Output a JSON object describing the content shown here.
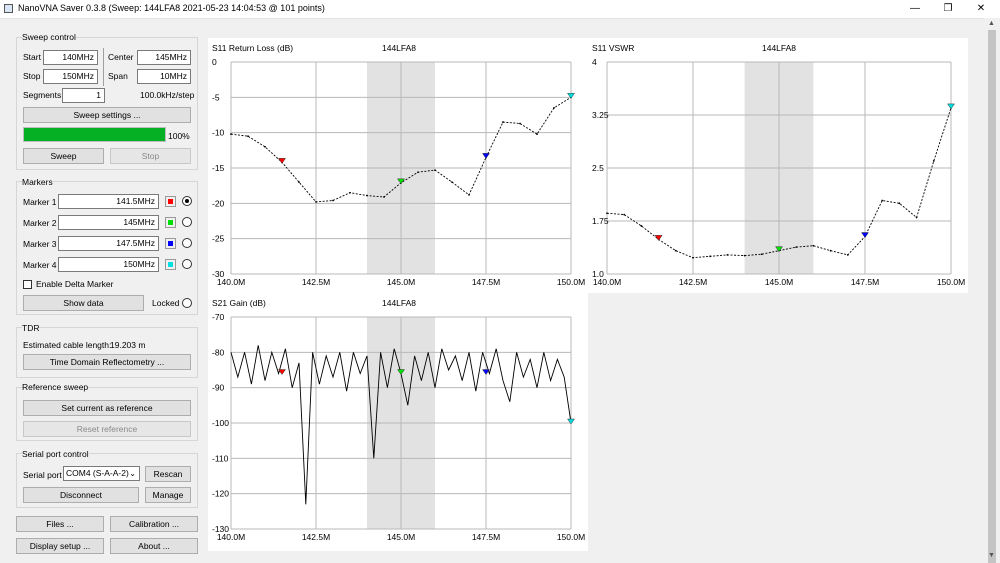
{
  "window": {
    "title": "NanoVNA Saver 0.3.8 (Sweep: 144LFA8 2021-05-23 14:04:53 @ 101 points)",
    "minimize": "—",
    "restore": "❐",
    "close": "✕"
  },
  "sweep_control": {
    "title": "Sweep control",
    "start_label": "Start",
    "start_value": "140MHz",
    "center_label": "Center",
    "center_value": "145MHz",
    "stop_label": "Stop",
    "stop_value": "150MHz",
    "span_label": "Span",
    "span_value": "10MHz",
    "segments_label": "Segments",
    "segments_value": "1",
    "step": "100.0kHz/step",
    "settings_button": "Sweep settings ...",
    "progress": 100,
    "progress_label": "100%",
    "sweep_button": "Sweep",
    "stop_button": "Stop"
  },
  "markers": {
    "title": "Markers",
    "items": [
      {
        "label": "Marker 1",
        "value": "141.5MHz",
        "color": "#ff0000",
        "selected": true
      },
      {
        "label": "Marker 2",
        "value": "145MHz",
        "color": "#00e000",
        "selected": false
      },
      {
        "label": "Marker 3",
        "value": "147.5MHz",
        "color": "#0000ff",
        "selected": false
      },
      {
        "label": "Marker 4",
        "value": "150MHz",
        "color": "#00e0e0",
        "selected": false
      }
    ],
    "delta_label": "Enable Delta Marker",
    "show_data_button": "Show data",
    "locked_label": "Locked"
  },
  "tdr": {
    "title": "TDR",
    "cable_label": "Estimated cable length:",
    "cable_value": "19.203 m",
    "button": "Time Domain Reflectometry ..."
  },
  "reference": {
    "title": "Reference sweep",
    "set_button": "Set current as reference",
    "reset_button": "Reset reference"
  },
  "serial": {
    "title": "Serial port control",
    "port_label": "Serial port",
    "port_value": "COM4 (S-A-A-2)",
    "rescan_button": "Rescan",
    "disconnect_button": "Disconnect",
    "manage_button": "Manage"
  },
  "bottom_buttons": {
    "files": "Files ...",
    "calibration": "Calibration ...",
    "display": "Display setup ...",
    "about": "About ..."
  },
  "charts": {
    "return_loss": {
      "title": "S11 Return Loss (dB)",
      "sweep_name": "144LFA8"
    },
    "vswr": {
      "title": "S11 VSWR",
      "sweep_name": "144LFA8"
    },
    "gain": {
      "title": "S21 Gain (dB)",
      "sweep_name": "144LFA8"
    }
  },
  "chart_data": [
    {
      "type": "line",
      "title": "S11 Return Loss (dB)",
      "x": [
        140.0,
        140.5,
        141.0,
        141.5,
        142.0,
        142.5,
        143.0,
        143.5,
        144.0,
        144.5,
        145.0,
        145.5,
        146.0,
        146.5,
        147.0,
        147.5,
        148.0,
        148.5,
        149.0,
        149.5,
        150.0
      ],
      "y": [
        -10.2,
        -10.5,
        -12.0,
        -14.2,
        -17.0,
        -19.8,
        -19.6,
        -18.5,
        -18.9,
        -19.1,
        -17.1,
        -15.6,
        -15.3,
        -17.0,
        -18.8,
        -13.5,
        -8.5,
        -8.7,
        -10.2,
        -6.5,
        -5.0
      ],
      "xticks": [
        "140.0M",
        "142.5M",
        "145.0M",
        "147.5M",
        "150.0M"
      ],
      "yticks": [
        "0",
        "-5",
        "-10",
        "-15",
        "-20",
        "-25",
        "-30"
      ],
      "xlim": [
        140,
        150
      ],
      "ylim": [
        -30,
        0
      ],
      "shaded_band": [
        144.0,
        146.0
      ],
      "markers": [
        {
          "x": 141.5,
          "y": -14.2,
          "color": "#ff0000"
        },
        {
          "x": 145.0,
          "y": -17.1,
          "color": "#00e000"
        },
        {
          "x": 147.5,
          "y": -13.5,
          "color": "#0000ff"
        },
        {
          "x": 150.0,
          "y": -5.0,
          "color": "#00e0e0"
        }
      ]
    },
    {
      "type": "line",
      "title": "S11 VSWR",
      "x": [
        140.0,
        140.5,
        141.0,
        141.5,
        142.0,
        142.5,
        143.0,
        143.5,
        144.0,
        144.5,
        145.0,
        145.5,
        146.0,
        146.5,
        147.0,
        147.5,
        148.0,
        148.5,
        149.0,
        149.5,
        150.0
      ],
      "y": [
        1.86,
        1.84,
        1.68,
        1.49,
        1.33,
        1.23,
        1.25,
        1.27,
        1.26,
        1.28,
        1.33,
        1.38,
        1.4,
        1.33,
        1.27,
        1.53,
        2.04,
        2.0,
        1.8,
        2.6,
        3.35
      ],
      "xticks": [
        "140.0M",
        "142.5M",
        "145.0M",
        "147.5M",
        "150.0M"
      ],
      "yticks": [
        "4",
        "3.25",
        "2.5",
        "1.75",
        "1.0"
      ],
      "xlim": [
        140,
        150
      ],
      "ylim": [
        1.0,
        4.0
      ],
      "shaded_band": [
        144.0,
        146.0
      ],
      "markers": [
        {
          "x": 141.5,
          "y": 1.49,
          "color": "#ff0000"
        },
        {
          "x": 145.0,
          "y": 1.33,
          "color": "#00e000"
        },
        {
          "x": 147.5,
          "y": 1.53,
          "color": "#0000ff"
        },
        {
          "x": 150.0,
          "y": 3.35,
          "color": "#00e0e0"
        }
      ]
    },
    {
      "type": "line",
      "title": "S21 Gain (dB)",
      "x": [
        140.0,
        140.2,
        140.4,
        140.6,
        140.8,
        141.0,
        141.2,
        141.4,
        141.6,
        141.8,
        142.0,
        142.2,
        142.4,
        142.6,
        142.8,
        143.0,
        143.2,
        143.4,
        143.6,
        143.8,
        144.0,
        144.2,
        144.4,
        144.6,
        144.8,
        145.0,
        145.2,
        145.4,
        145.6,
        145.8,
        146.0,
        146.2,
        146.4,
        146.6,
        146.8,
        147.0,
        147.2,
        147.4,
        147.6,
        147.8,
        148.0,
        148.2,
        148.4,
        148.6,
        148.8,
        149.0,
        149.2,
        149.4,
        149.6,
        149.8,
        150.0
      ],
      "y": [
        -80,
        -87,
        -80,
        -89,
        -78,
        -88,
        -80,
        -86,
        -79,
        -90,
        -83,
        -123,
        -80,
        -89,
        -81,
        -87,
        -80,
        -91,
        -80,
        -86,
        -81,
        -110,
        -80,
        -90,
        -79,
        -86,
        -95,
        -81,
        -88,
        -80,
        -90,
        -79,
        -85,
        -81,
        -88,
        -80,
        -91,
        -80,
        -86,
        -79,
        -88,
        -94,
        -80,
        -87,
        -82,
        -90,
        -80,
        -88,
        -82,
        -87,
        -100
      ],
      "xticks": [
        "140.0M",
        "142.5M",
        "145.0M",
        "147.5M",
        "150.0M"
      ],
      "yticks": [
        "-70",
        "-80",
        "-90",
        "-100",
        "-110",
        "-120",
        "-130"
      ],
      "xlim": [
        140,
        150
      ],
      "ylim": [
        -130,
        -70
      ],
      "shaded_band": [
        144.0,
        146.0
      ],
      "markers": [
        {
          "x": 141.5,
          "y": -86,
          "color": "#ff0000"
        },
        {
          "x": 145.0,
          "y": -86,
          "color": "#00e000"
        },
        {
          "x": 147.5,
          "y": -86,
          "color": "#0000ff"
        },
        {
          "x": 150.0,
          "y": -100,
          "color": "#00e0e0"
        }
      ]
    }
  ]
}
